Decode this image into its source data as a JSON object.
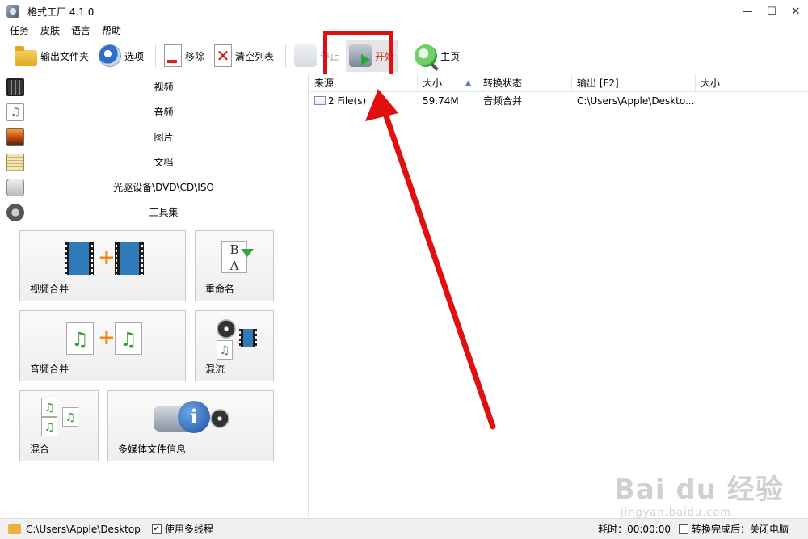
{
  "window": {
    "title": "格式工厂 4.1.0",
    "controls": {
      "minimize": "—",
      "maximize": "☐",
      "close": "✕"
    }
  },
  "menu": [
    "任务",
    "皮肤",
    "语言",
    "帮助"
  ],
  "toolbar": {
    "output_folder": "输出文件夹",
    "options": "选项",
    "remove": "移除",
    "clear_list": "清空列表",
    "stop": "停止",
    "start": "开始",
    "home": "主页"
  },
  "categories": [
    {
      "label": "视频",
      "icon": "video-icon"
    },
    {
      "label": "音频",
      "icon": "audio-icon"
    },
    {
      "label": "图片",
      "icon": "picture-icon"
    },
    {
      "label": "文档",
      "icon": "document-icon"
    },
    {
      "label": "光驱设备\\DVD\\CD\\ISO",
      "icon": "disc-icon"
    },
    {
      "label": "工具集",
      "icon": "tools-icon"
    }
  ],
  "tools": {
    "video_merge": "视频合并",
    "rename": "重命名",
    "audio_merge": "音频合并",
    "mux": "混流",
    "mix": "混合",
    "media_info": "多媒体文件信息"
  },
  "table": {
    "columns": [
      "来源",
      "大小",
      "转换状态",
      "输出 [F2]",
      "大小"
    ],
    "rows": [
      {
        "source": "2 File(s)",
        "size": "59.74M",
        "status": "音频合并",
        "output": "C:\\Users\\Apple\\Deskto...",
        "out_size": ""
      }
    ]
  },
  "status": {
    "output_path": "C:\\Users\\Apple\\Desktop",
    "multithread_label": "使用多线程",
    "multithread_checked": true,
    "elapsed_label": "耗时：00:00:00",
    "after_convert_label": "转换完成后：关闭电脑",
    "after_convert_checked": false
  },
  "watermark": {
    "main": "Bai du 经验",
    "sub": "jingyan.baidu.com"
  },
  "colors": {
    "highlight": "#e01010",
    "start_text": "#c0392b"
  }
}
